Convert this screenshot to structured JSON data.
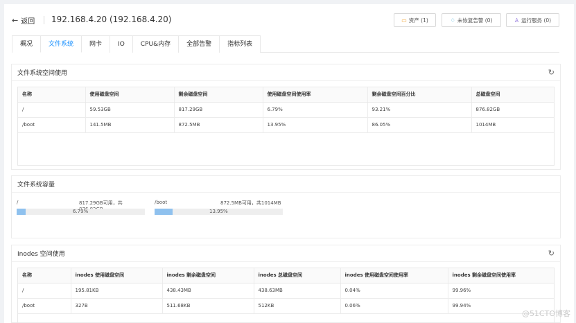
{
  "header": {
    "back_label": "返回",
    "title": "192.168.4.20 (192.168.4.20)",
    "assets_label": "资产 (1)",
    "alarm_label": "未恢复告警 (0)",
    "services_label": "运行服务 (0)"
  },
  "tabs": [
    "概况",
    "文件系统",
    "网卡",
    "IO",
    "CPU&内存",
    "全部告警",
    "指标列表"
  ],
  "fs_usage": {
    "title": "文件系统空间使用",
    "columns": [
      "名称",
      "使用磁盘空间",
      "剩余磁盘空间",
      "使用磁盘空间使用率",
      "剩余磁盘空间百分比",
      "总磁盘空间"
    ],
    "rows": [
      [
        "/",
        "59.53GB",
        "817.29GB",
        "6.79%",
        "93.21%",
        "876.82GB"
      ],
      [
        "/boot",
        "141.5MB",
        "872.5MB",
        "13.95%",
        "86.05%",
        "1014MB"
      ]
    ]
  },
  "fs_capacity": {
    "title": "文件系统容量",
    "items": [
      {
        "mount": "/",
        "info": "817.29GB可用，共876.82GB",
        "percent_label": "6.79%",
        "percent": 6.79
      },
      {
        "mount": "/boot",
        "info": "872.5MB可用，共1014MB",
        "percent_label": "13.95%",
        "percent": 13.95
      }
    ]
  },
  "inodes": {
    "title": "Inodes 空间使用",
    "columns": [
      "名称",
      "inodes 使用磁盘空间",
      "inodes 剩余磁盘空间",
      "inodes 总磁盘空间",
      "inodes 使用磁盘空间使用率",
      "inodes 剩余磁盘空间使用率"
    ],
    "rows": [
      [
        "/",
        "195.81KB",
        "438.43MB",
        "438.63MB",
        "0.04%",
        "99.96%"
      ],
      [
        "/boot",
        "327B",
        "511.68KB",
        "512KB",
        "0.06%",
        "99.94%"
      ]
    ]
  },
  "watermark": "@51CTO博客"
}
